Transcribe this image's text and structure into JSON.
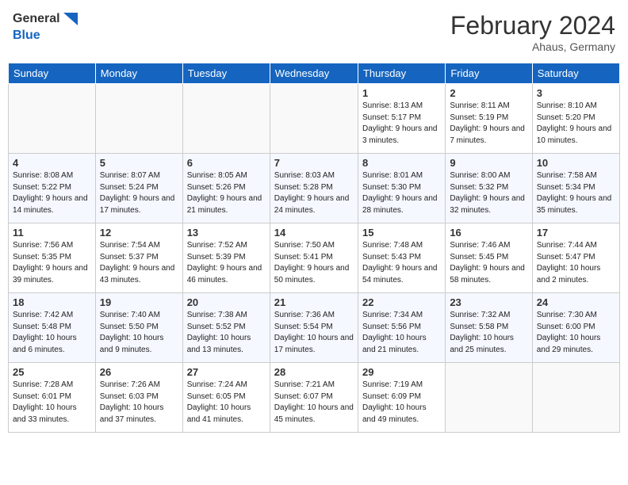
{
  "header": {
    "logo_general": "General",
    "logo_blue": "Blue",
    "title": "February 2024",
    "subtitle": "Ahaus, Germany"
  },
  "days_of_week": [
    "Sunday",
    "Monday",
    "Tuesday",
    "Wednesday",
    "Thursday",
    "Friday",
    "Saturday"
  ],
  "weeks": [
    [
      {
        "day": "",
        "info": ""
      },
      {
        "day": "",
        "info": ""
      },
      {
        "day": "",
        "info": ""
      },
      {
        "day": "",
        "info": ""
      },
      {
        "day": "1",
        "info": "Sunrise: 8:13 AM\nSunset: 5:17 PM\nDaylight: 9 hours\nand 3 minutes."
      },
      {
        "day": "2",
        "info": "Sunrise: 8:11 AM\nSunset: 5:19 PM\nDaylight: 9 hours\nand 7 minutes."
      },
      {
        "day": "3",
        "info": "Sunrise: 8:10 AM\nSunset: 5:20 PM\nDaylight: 9 hours\nand 10 minutes."
      }
    ],
    [
      {
        "day": "4",
        "info": "Sunrise: 8:08 AM\nSunset: 5:22 PM\nDaylight: 9 hours\nand 14 minutes."
      },
      {
        "day": "5",
        "info": "Sunrise: 8:07 AM\nSunset: 5:24 PM\nDaylight: 9 hours\nand 17 minutes."
      },
      {
        "day": "6",
        "info": "Sunrise: 8:05 AM\nSunset: 5:26 PM\nDaylight: 9 hours\nand 21 minutes."
      },
      {
        "day": "7",
        "info": "Sunrise: 8:03 AM\nSunset: 5:28 PM\nDaylight: 9 hours\nand 24 minutes."
      },
      {
        "day": "8",
        "info": "Sunrise: 8:01 AM\nSunset: 5:30 PM\nDaylight: 9 hours\nand 28 minutes."
      },
      {
        "day": "9",
        "info": "Sunrise: 8:00 AM\nSunset: 5:32 PM\nDaylight: 9 hours\nand 32 minutes."
      },
      {
        "day": "10",
        "info": "Sunrise: 7:58 AM\nSunset: 5:34 PM\nDaylight: 9 hours\nand 35 minutes."
      }
    ],
    [
      {
        "day": "11",
        "info": "Sunrise: 7:56 AM\nSunset: 5:35 PM\nDaylight: 9 hours\nand 39 minutes."
      },
      {
        "day": "12",
        "info": "Sunrise: 7:54 AM\nSunset: 5:37 PM\nDaylight: 9 hours\nand 43 minutes."
      },
      {
        "day": "13",
        "info": "Sunrise: 7:52 AM\nSunset: 5:39 PM\nDaylight: 9 hours\nand 46 minutes."
      },
      {
        "day": "14",
        "info": "Sunrise: 7:50 AM\nSunset: 5:41 PM\nDaylight: 9 hours\nand 50 minutes."
      },
      {
        "day": "15",
        "info": "Sunrise: 7:48 AM\nSunset: 5:43 PM\nDaylight: 9 hours\nand 54 minutes."
      },
      {
        "day": "16",
        "info": "Sunrise: 7:46 AM\nSunset: 5:45 PM\nDaylight: 9 hours\nand 58 minutes."
      },
      {
        "day": "17",
        "info": "Sunrise: 7:44 AM\nSunset: 5:47 PM\nDaylight: 10 hours\nand 2 minutes."
      }
    ],
    [
      {
        "day": "18",
        "info": "Sunrise: 7:42 AM\nSunset: 5:48 PM\nDaylight: 10 hours\nand 6 minutes."
      },
      {
        "day": "19",
        "info": "Sunrise: 7:40 AM\nSunset: 5:50 PM\nDaylight: 10 hours\nand 9 minutes."
      },
      {
        "day": "20",
        "info": "Sunrise: 7:38 AM\nSunset: 5:52 PM\nDaylight: 10 hours\nand 13 minutes."
      },
      {
        "day": "21",
        "info": "Sunrise: 7:36 AM\nSunset: 5:54 PM\nDaylight: 10 hours\nand 17 minutes."
      },
      {
        "day": "22",
        "info": "Sunrise: 7:34 AM\nSunset: 5:56 PM\nDaylight: 10 hours\nand 21 minutes."
      },
      {
        "day": "23",
        "info": "Sunrise: 7:32 AM\nSunset: 5:58 PM\nDaylight: 10 hours\nand 25 minutes."
      },
      {
        "day": "24",
        "info": "Sunrise: 7:30 AM\nSunset: 6:00 PM\nDaylight: 10 hours\nand 29 minutes."
      }
    ],
    [
      {
        "day": "25",
        "info": "Sunrise: 7:28 AM\nSunset: 6:01 PM\nDaylight: 10 hours\nand 33 minutes."
      },
      {
        "day": "26",
        "info": "Sunrise: 7:26 AM\nSunset: 6:03 PM\nDaylight: 10 hours\nand 37 minutes."
      },
      {
        "day": "27",
        "info": "Sunrise: 7:24 AM\nSunset: 6:05 PM\nDaylight: 10 hours\nand 41 minutes."
      },
      {
        "day": "28",
        "info": "Sunrise: 7:21 AM\nSunset: 6:07 PM\nDaylight: 10 hours\nand 45 minutes."
      },
      {
        "day": "29",
        "info": "Sunrise: 7:19 AM\nSunset: 6:09 PM\nDaylight: 10 hours\nand 49 minutes."
      },
      {
        "day": "",
        "info": ""
      },
      {
        "day": "",
        "info": ""
      }
    ]
  ]
}
